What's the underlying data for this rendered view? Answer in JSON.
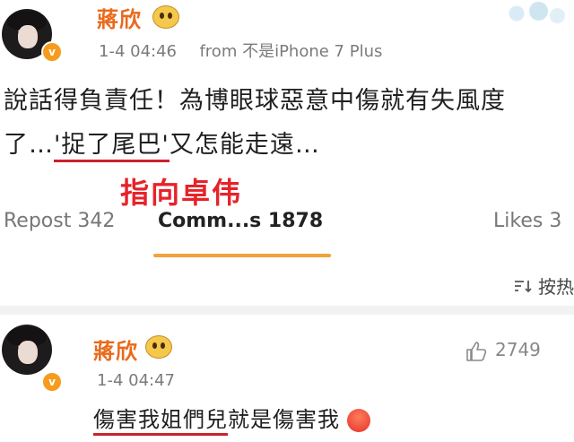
{
  "post": {
    "author": "蔣欣",
    "time": "1-4 04:46",
    "source": "from  不是iPhone 7 Plus",
    "verified_badge": "v",
    "content_line1": "說話得負責任！為博眼球惡意中傷就有失風度",
    "content_line2_prefix": "了…",
    "content_line2_highlight": "'捉了尾巴'",
    "content_line2_suffix": "又怎能走遠…"
  },
  "annotation": "指向卓伟",
  "tabs": {
    "repost": "Repost 342",
    "comments": "Comm...s 1878",
    "likes": "Likes 3"
  },
  "sort": {
    "icon": "sort-icon",
    "label": "按热"
  },
  "comment": {
    "author": "蔣欣",
    "time": "1-4 04:47",
    "highlight": "傷害我姐們兒",
    "suffix": "就是傷害我",
    "like_count": "2749",
    "emoji": "angry-face-icon"
  },
  "colors": {
    "name": "#ea6a1c",
    "tab_indicator": "#f2a33a",
    "annotation": "#e6232a",
    "underline": "#c9222c"
  }
}
